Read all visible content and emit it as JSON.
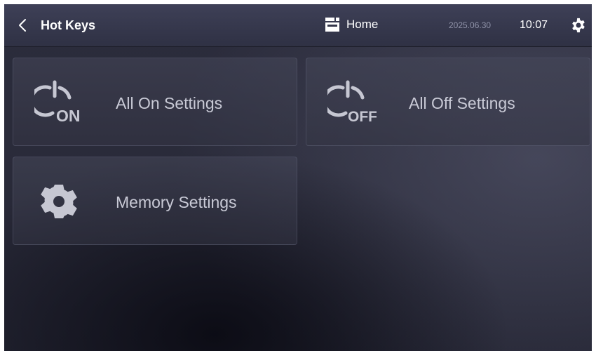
{
  "topbar": {
    "back_icon": "chevron-left-icon",
    "title": "Hot Keys",
    "home_icon": "home-icon",
    "home_label": "Home",
    "date": "2025.06.30",
    "time": "10:07",
    "settings_icon": "gear-icon"
  },
  "tiles": [
    {
      "icon": "power-on-icon",
      "icon_text": "ON",
      "label": "All On Settings"
    },
    {
      "icon": "power-off-icon",
      "icon_text": "OFF",
      "label": "All Off Settings"
    },
    {
      "icon": "gear-icon",
      "label": "Memory Settings"
    }
  ],
  "colors": {
    "background": "#2a2b3a",
    "topbar": "#3a3c52",
    "tile": "#40425a",
    "label_text": "#c9cad6",
    "icon": "#c6c7d2"
  }
}
